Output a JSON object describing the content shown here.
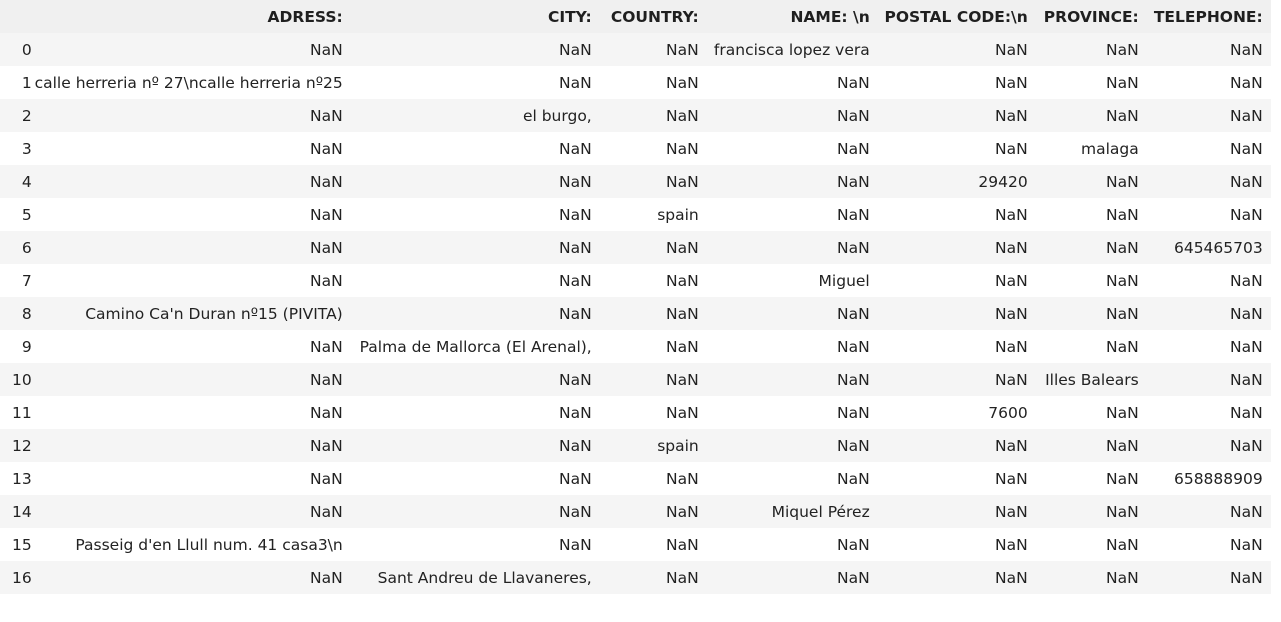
{
  "table": {
    "headers": [
      "",
      "ADRESS:",
      "CITY:",
      "COUNTRY:",
      "NAME: \\n",
      "POSTAL CODE:\\n",
      "PROVINCE:",
      "TELEPHONE:"
    ],
    "rows": [
      [
        "0",
        "NaN",
        "NaN",
        "NaN",
        "francisca lopez vera",
        "NaN",
        "NaN",
        "NaN"
      ],
      [
        "1",
        "calle herreria nº 27\\ncalle herreria nº25",
        "NaN",
        "NaN",
        "NaN",
        "NaN",
        "NaN",
        "NaN"
      ],
      [
        "2",
        "NaN",
        "el burgo,",
        "NaN",
        "NaN",
        "NaN",
        "NaN",
        "NaN"
      ],
      [
        "3",
        "NaN",
        "NaN",
        "NaN",
        "NaN",
        "NaN",
        "malaga",
        "NaN"
      ],
      [
        "4",
        "NaN",
        "NaN",
        "NaN",
        "NaN",
        "29420",
        "NaN",
        "NaN"
      ],
      [
        "5",
        "NaN",
        "NaN",
        "spain",
        "NaN",
        "NaN",
        "NaN",
        "NaN"
      ],
      [
        "6",
        "NaN",
        "NaN",
        "NaN",
        "NaN",
        "NaN",
        "NaN",
        "645465703"
      ],
      [
        "7",
        "NaN",
        "NaN",
        "NaN",
        "Miguel",
        "NaN",
        "NaN",
        "NaN"
      ],
      [
        "8",
        "Camino Ca'n Duran nº15 (PIVITA)",
        "NaN",
        "NaN",
        "NaN",
        "NaN",
        "NaN",
        "NaN"
      ],
      [
        "9",
        "NaN",
        "Palma de Mallorca (El Arenal),",
        "NaN",
        "NaN",
        "NaN",
        "NaN",
        "NaN"
      ],
      [
        "10",
        "NaN",
        "NaN",
        "NaN",
        "NaN",
        "NaN",
        "Illes Balears",
        "NaN"
      ],
      [
        "11",
        "NaN",
        "NaN",
        "NaN",
        "NaN",
        "7600",
        "NaN",
        "NaN"
      ],
      [
        "12",
        "NaN",
        "NaN",
        "spain",
        "NaN",
        "NaN",
        "NaN",
        "NaN"
      ],
      [
        "13",
        "NaN",
        "NaN",
        "NaN",
        "NaN",
        "NaN",
        "NaN",
        "658888909"
      ],
      [
        "14",
        "NaN",
        "NaN",
        "NaN",
        "Miquel Pérez",
        "NaN",
        "NaN",
        "NaN"
      ],
      [
        "15",
        "Passeig d'en Llull num. 41 casa3\\n",
        "NaN",
        "NaN",
        "NaN",
        "NaN",
        "NaN",
        "NaN"
      ],
      [
        "16",
        "NaN",
        "Sant Andreu de Llavaneres,",
        "NaN",
        "NaN",
        "NaN",
        "NaN",
        "NaN"
      ]
    ]
  },
  "colors": {
    "header_bg": "#f0f0f0",
    "stripe_bg": "#f5f5f5",
    "row_bg": "#ffffff",
    "text": "#222222"
  }
}
